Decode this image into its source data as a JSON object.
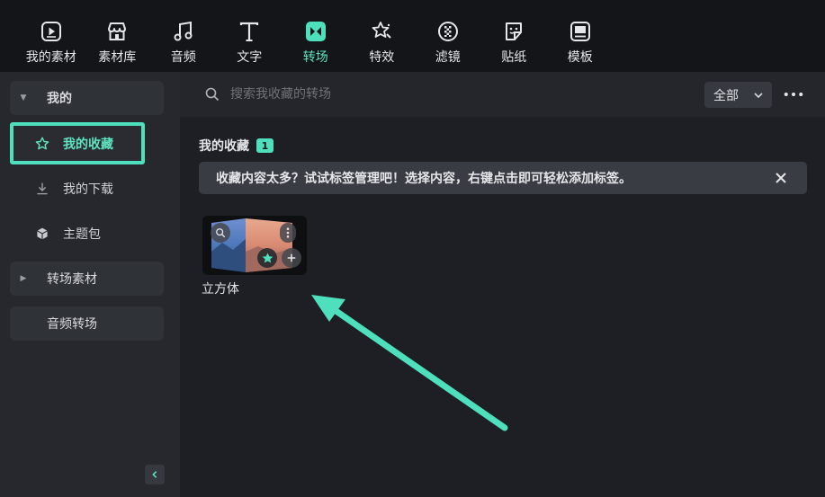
{
  "toolbar": {
    "items": [
      {
        "label": "我的素材",
        "icon": "my-media-icon",
        "active": false
      },
      {
        "label": "素材库",
        "icon": "store-icon",
        "active": false
      },
      {
        "label": "音频",
        "icon": "music-note-icon",
        "active": false
      },
      {
        "label": "文字",
        "icon": "text-icon",
        "active": false
      },
      {
        "label": "转场",
        "icon": "transition-icon",
        "active": true
      },
      {
        "label": "特效",
        "icon": "effects-icon",
        "active": false
      },
      {
        "label": "滤镜",
        "icon": "filter-icon",
        "active": false
      },
      {
        "label": "贴纸",
        "icon": "sticker-icon",
        "active": false
      },
      {
        "label": "模板",
        "icon": "template-icon",
        "active": false
      }
    ]
  },
  "sidebar": {
    "group_mine": "我的",
    "items": [
      {
        "label": "我的收藏",
        "icon": "star-icon",
        "selected": true
      },
      {
        "label": "我的下载",
        "icon": "download-icon",
        "selected": false
      },
      {
        "label": "主题包",
        "icon": "theme-pack-icon",
        "selected": false
      }
    ],
    "group_transition_assets": "转场素材",
    "group_audio_transition": "音频转场"
  },
  "search": {
    "placeholder": "搜索我收藏的转场",
    "value": ""
  },
  "filter": {
    "selected": "全部"
  },
  "main": {
    "section_title": "我的收藏",
    "count": "1",
    "tip": "收藏内容太多？试试标签管理吧！选择内容，右键点击即可轻松添加标签。"
  },
  "cards": [
    {
      "name": "立方体",
      "favorited": true
    }
  ],
  "colors": {
    "accent": "#4ee0bc",
    "toolbar_bg": "#141518",
    "sidebar_bg": "#26282d",
    "main_bg": "#1d1f24"
  }
}
